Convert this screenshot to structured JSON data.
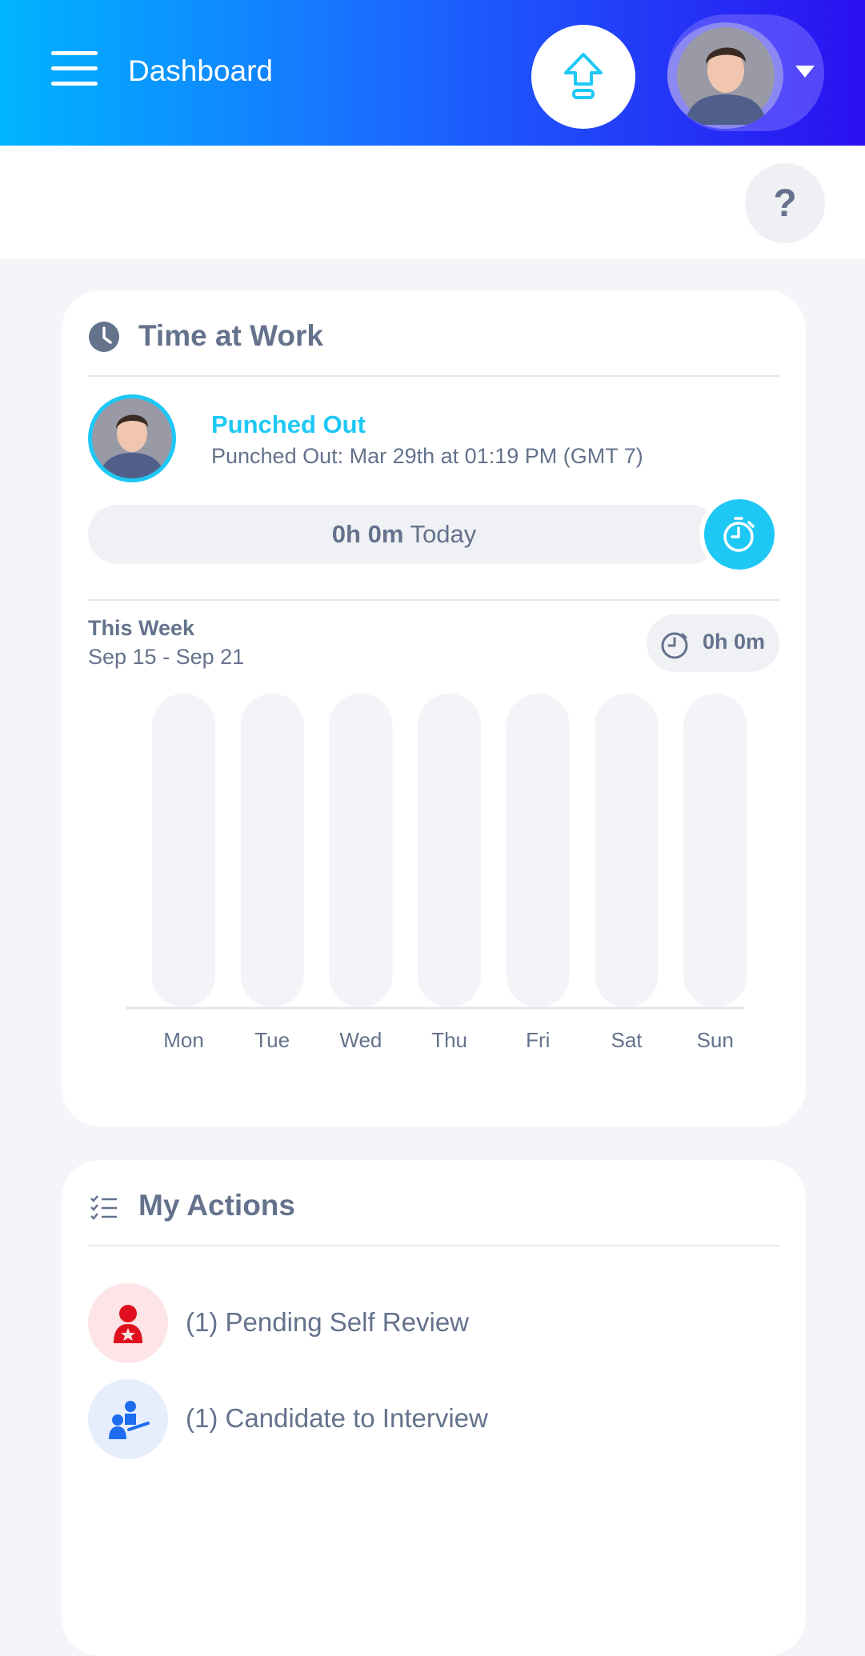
{
  "topbar": {
    "title": "Dashboard",
    "menu_icon": "hamburger-menu-icon",
    "upgrade_icon": "upload-arrow-icon",
    "profile_caret_icon": "caret-down-icon",
    "gradient_start": "#00b5ff",
    "gradient_end": "#2a10f0"
  },
  "help": {
    "label": "?"
  },
  "time_at_work": {
    "title": "Time at Work",
    "icon": "clock-icon",
    "status": "Punched Out",
    "status_detail": "Punched Out: Mar 29th at 01:19 PM (GMT 7)",
    "today_value": "0h 0m",
    "today_label": "Today",
    "timer_icon": "stopwatch-icon",
    "accent_color": "#1ec8f5",
    "week_label": "This Week",
    "week_range": "Sep 15 - Sep 21",
    "week_total": "0h 0m"
  },
  "chart_data": {
    "type": "bar",
    "categories": [
      "Mon",
      "Tue",
      "Wed",
      "Thu",
      "Fri",
      "Sat",
      "Sun"
    ],
    "values": [
      0,
      0,
      0,
      0,
      0,
      0,
      0
    ],
    "title": "",
    "xlabel": "",
    "ylabel": "",
    "grid": false
  },
  "my_actions": {
    "title": "My Actions",
    "icon": "checklist-icon",
    "items": [
      {
        "label": "(1) Pending Self Review",
        "icon": "self-review-icon",
        "color": "#e0101e",
        "bg": "#fde4e6"
      },
      {
        "label": "(1) Candidate to Interview",
        "icon": "interview-icon",
        "color": "#1e6cf0",
        "bg": "#e6eefc"
      }
    ]
  }
}
